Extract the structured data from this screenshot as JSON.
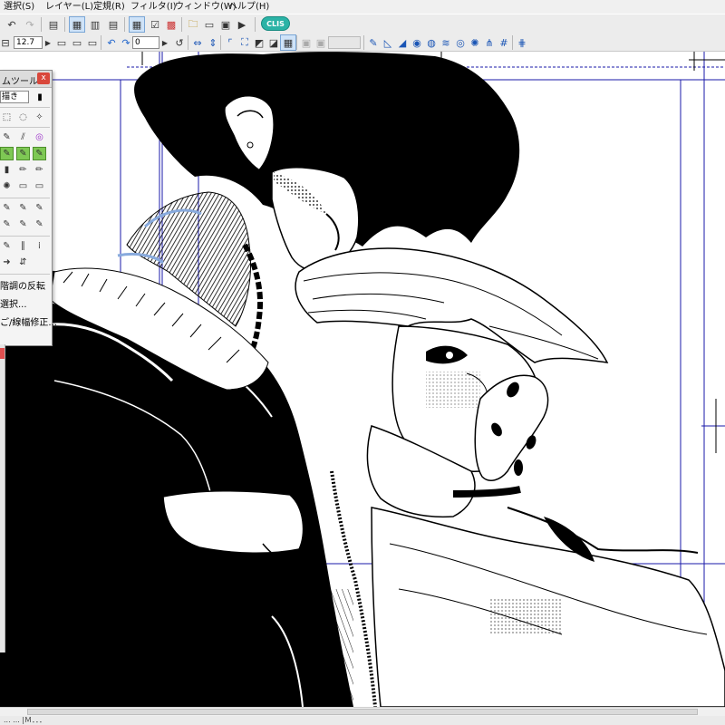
{
  "menubar": {
    "items": [
      "選択(S)",
      "レイヤー(L)",
      "定規(R)",
      "フィルタ(I)",
      "ウィンドウ(W)",
      "ヘルプ(H)"
    ]
  },
  "toolbar": {
    "undo_icon": "undo-icon",
    "redo_icon": "redo-icon",
    "print_icon": "print-icon",
    "logo_text": "CLIS",
    "zoom_value": "12.7",
    "rotate_value": "0"
  },
  "palette": {
    "title": "ムツール",
    "close_label": "x",
    "selector_value": "描き",
    "menu_items": [
      "階調の反転",
      "選択...",
      "ご/線幅修正..."
    ]
  },
  "statusbar": {
    "text": "... ... |Ｍ．．．"
  },
  "colors": {
    "chrome": "#f0f0f0",
    "guide_blue": "#1a1aa8",
    "accent_teal": "#2bb3a6",
    "close_red": "#d9473b"
  }
}
